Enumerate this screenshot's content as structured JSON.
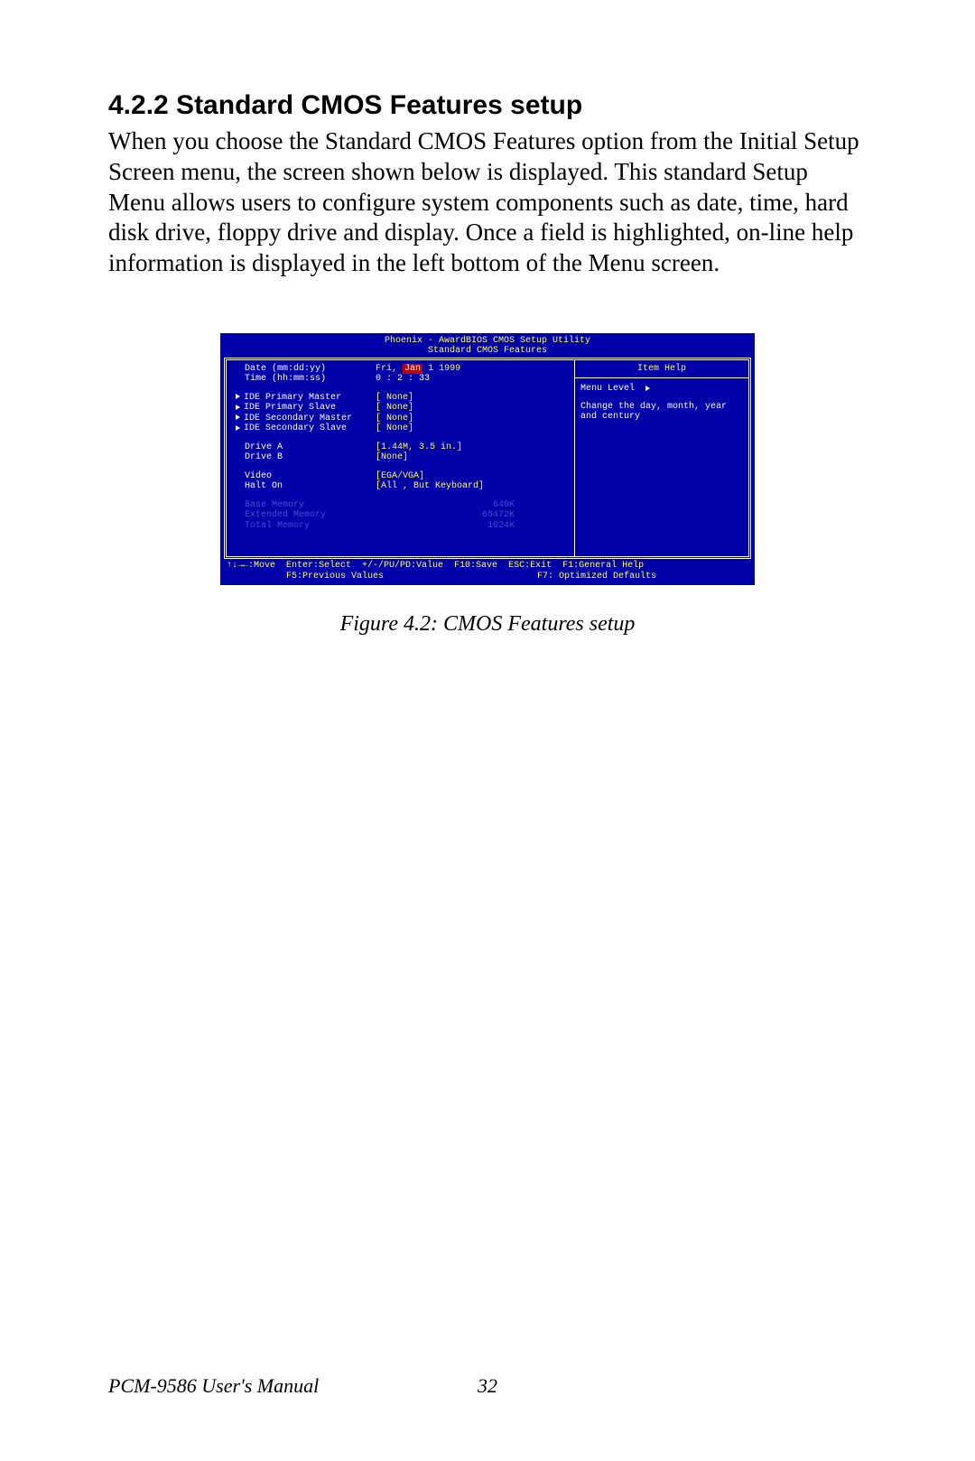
{
  "heading": "4.2.2 Standard CMOS Features setup",
  "paragraph": "When you choose the Standard CMOS Features option from the Initial Setup Screen menu, the screen shown below is displayed. This standard Setup Menu allows users to configure system components such as date, time, hard disk drive, floppy drive and display. Once a field is highlighted, on-line help information is displayed in the left bottom of the Menu screen.",
  "bios": {
    "title_line1": "Phoenix - AwardBIOS CMOS Setup Utility",
    "title_line2": "Standard CMOS Features",
    "rows": {
      "date_label": "Date (mm:dd:yy)",
      "date_prefix": "Fri,",
      "date_selected": "Jan",
      "date_rest": "1 1999",
      "time_label": "Time (hh:mm:ss)",
      "time_value": "0 :  2 : 33",
      "ide_pm_label": "IDE Primary Master",
      "ide_pm_val": "[ None]",
      "ide_ps_label": "IDE Primary Slave",
      "ide_ps_val": "[ None]",
      "ide_sm_label": "IDE Secondary Master",
      "ide_sm_val": "[ None]",
      "ide_ss_label": "IDE Secondary Slave",
      "ide_ss_val": "[ None]",
      "drive_a_label": "Drive A",
      "drive_a_val": "[1.44M, 3.5 in.]",
      "drive_b_label": "Drive B",
      "drive_b_val": "[None]",
      "video_label": "Video",
      "video_val": "[EGA/VGA]",
      "halt_label": "Halt On",
      "halt_val": "[All , But Keyboard]",
      "base_mem_label": "Base Memory",
      "base_mem_val": "640K",
      "ext_mem_label": "Extended Memory",
      "ext_mem_val": "65472K",
      "total_mem_label": "Total Memory",
      "total_mem_val": "1024K"
    },
    "help": {
      "title": "Item Help",
      "menu_level": "Menu Level",
      "text": "Change the day, month, year and century"
    },
    "footer": {
      "move": "↑↓→←:Move",
      "enter": "Enter:Select",
      "pupd": "+/-/PU/PD:Value",
      "f10": "F10:Save",
      "esc": "ESC:Exit",
      "f1": "F1:General Help",
      "f5": "F5:Previous Values",
      "f7": "F7: Optimized Defaults"
    }
  },
  "figure_caption": "Figure 4.2: CMOS Features setup",
  "footer_manual": "PCM-9586 User's Manual",
  "page_number": "32"
}
